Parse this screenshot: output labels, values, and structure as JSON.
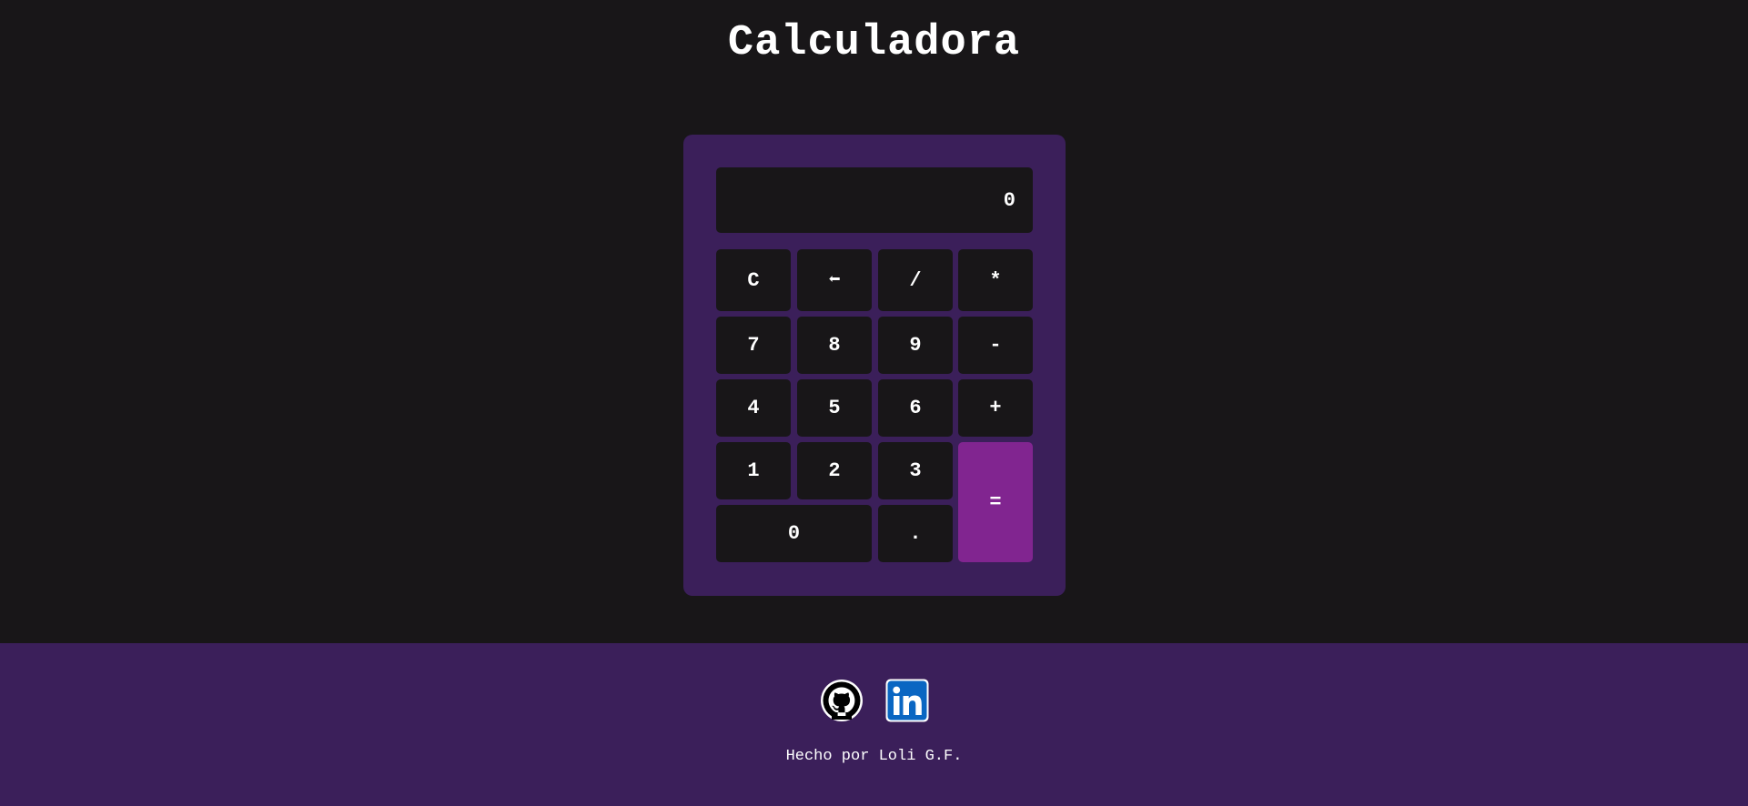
{
  "header": {
    "title": "Calculadora"
  },
  "calculator": {
    "display_value": "0",
    "keys": {
      "clear": "C",
      "backspace": "⬅",
      "divide": "/",
      "multiply": "*",
      "seven": "7",
      "eight": "8",
      "nine": "9",
      "subtract": "-",
      "four": "4",
      "five": "5",
      "six": "6",
      "add": "+",
      "one": "1",
      "two": "2",
      "three": "3",
      "equals": "=",
      "zero": "0",
      "decimal": "."
    }
  },
  "footer": {
    "links": [
      {
        "name": "github",
        "icon": "github-icon"
      },
      {
        "name": "linkedin",
        "icon": "linkedin-icon"
      }
    ],
    "credit": "Hecho por Loli G.F."
  },
  "colors": {
    "background": "#181618",
    "panel": "#3b1f5a",
    "key": "#181618",
    "equals_key": "#812590",
    "text": "#ffffff",
    "linkedin_blue": "#0a66c2"
  }
}
